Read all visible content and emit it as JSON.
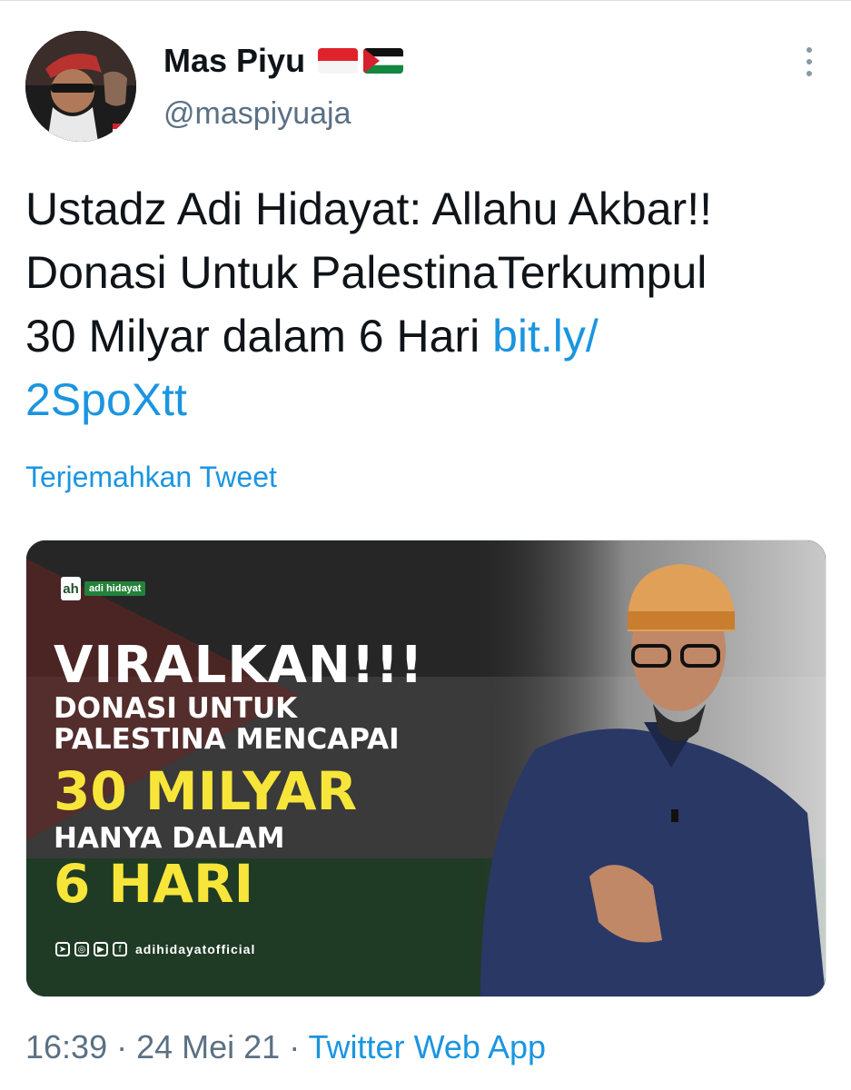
{
  "user": {
    "name": "Mas Piyu",
    "handle": "@maspiyuaja",
    "flags": [
      "indonesia-flag",
      "palestine-flag"
    ]
  },
  "tweet": {
    "text_line1": "Ustadz Adi Hidayat: Allahu Akbar!!",
    "text_line2": "Donasi Untuk PalestinaTerkumpul",
    "text_line3": "30 Milyar dalam 6 Hari ",
    "link_part1": "bit.ly/",
    "link_part2": "2SpoXtt",
    "translate_label": "Terjemahkan Tweet"
  },
  "media": {
    "logo_mark": "ah",
    "logo_text": "adi hidayat",
    "headline": "VIRALKAN!!!",
    "line1": "DONASI UNTUK",
    "line2": "PALESTINA MENCAPAI",
    "amount": "30 MILYAR",
    "line3": "HANYA DALAM",
    "days": "6 HARI",
    "social_handle": "adihidayatofficial"
  },
  "meta": {
    "time": "16:39",
    "separator": " · ",
    "date": "24 Mei 21",
    "app": "Twitter Web App"
  },
  "colors": {
    "link": "#1b95e0",
    "secondary_text": "#5b7083",
    "poster_yellow": "#f8e53a"
  }
}
